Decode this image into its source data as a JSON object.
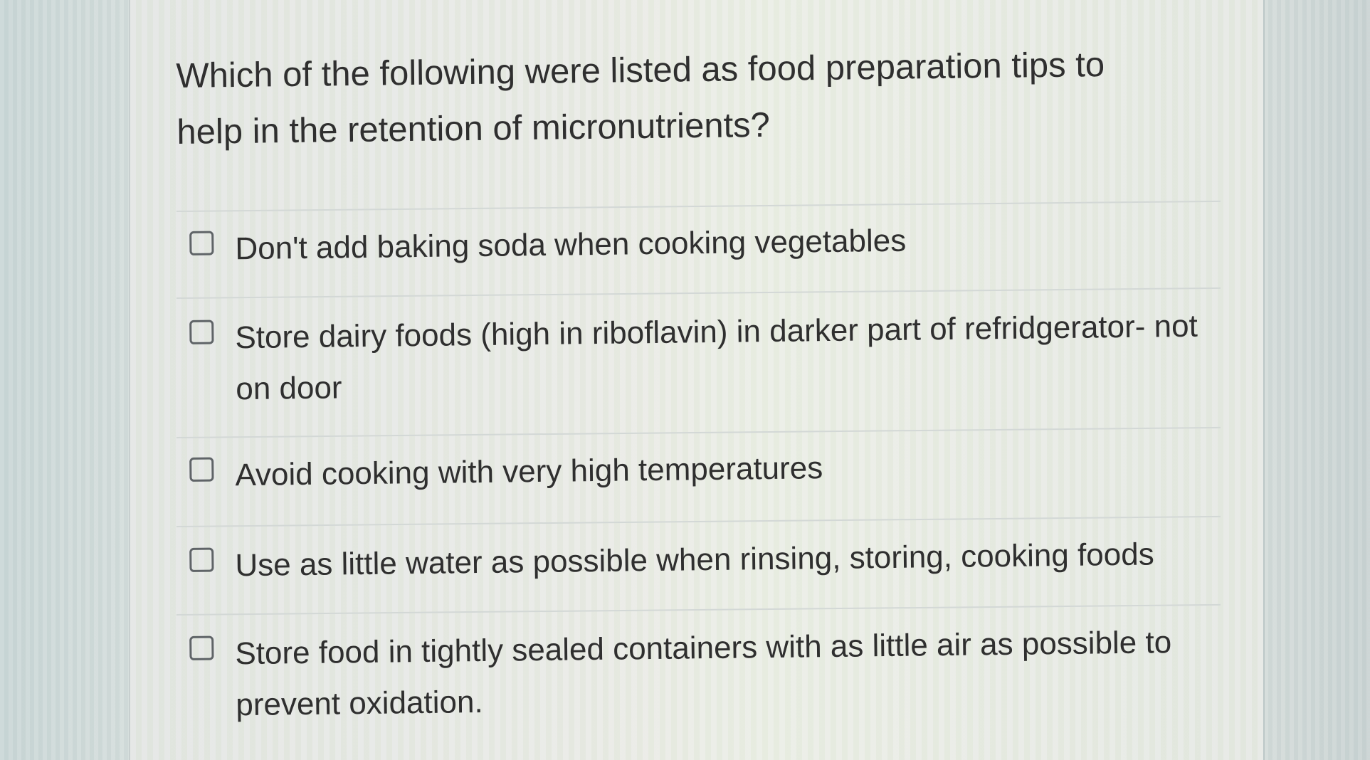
{
  "question": {
    "text": "Which of the following were listed as food preparation tips to help in the retention of micronutrients?"
  },
  "options": [
    {
      "label": "Don't add baking soda when cooking vegetables",
      "checked": false
    },
    {
      "label": "Store dairy foods (high in riboflavin) in darker part of refridgerator- not on door",
      "checked": false
    },
    {
      "label": "Avoid cooking with very high temperatures",
      "checked": false
    },
    {
      "label": "Use as little water as possible when rinsing, storing, cooking foods",
      "checked": false
    },
    {
      "label": "Store food in tightly sealed containers with as little air as possible to prevent oxidation.",
      "checked": false
    }
  ],
  "colors": {
    "text": "#2f2f2f",
    "checkbox_border": "#5f6467",
    "divider": "#d3d8d6"
  }
}
